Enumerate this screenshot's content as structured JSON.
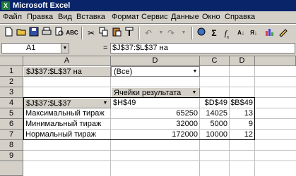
{
  "window": {
    "title": "Microsoft Excel",
    "app_icon": "excel-app-icon"
  },
  "menu": [
    "Файл",
    "Правка",
    "Вид",
    "Вставка",
    "Формат",
    "Сервис",
    "Данные",
    "Окно",
    "Справка"
  ],
  "toolbar": {
    "icons": [
      "new-icon",
      "open-icon",
      "save-icon",
      "print-icon",
      "print-preview-icon",
      "spelling-icon",
      "cut-icon",
      "copy-icon",
      "paste-icon",
      "format-painter-icon",
      "undo-icon",
      "redo-icon",
      "hyperlink-icon",
      "autosum-icon",
      "function-icon"
    ]
  },
  "formula_bar": {
    "name_box": "A1",
    "equals": "=",
    "formula": "$J$37:$L$37 на"
  },
  "columns": [
    "A",
    "D",
    "C",
    "D"
  ],
  "rows": [
    "1",
    "2",
    "3",
    "4",
    "5",
    "6",
    "7",
    "8",
    "9"
  ],
  "pivot": {
    "page_field": "$J$37:$L$37 на",
    "page_value": "(Все)",
    "data_header": "Ячейки результата",
    "row_field": "$J$37:$L$37",
    "col_headers": [
      "$H$49",
      "$D$49",
      "$B$49"
    ],
    "rows": [
      {
        "label": "Максимальный тираж",
        "values": [
          "65250",
          "14025",
          "13"
        ]
      },
      {
        "label": "Минимальный тираж",
        "values": [
          "32000",
          "5000",
          "9"
        ]
      },
      {
        "label": "Нормальный тираж",
        "values": [
          "172000",
          "10000",
          "12"
        ]
      }
    ]
  }
}
